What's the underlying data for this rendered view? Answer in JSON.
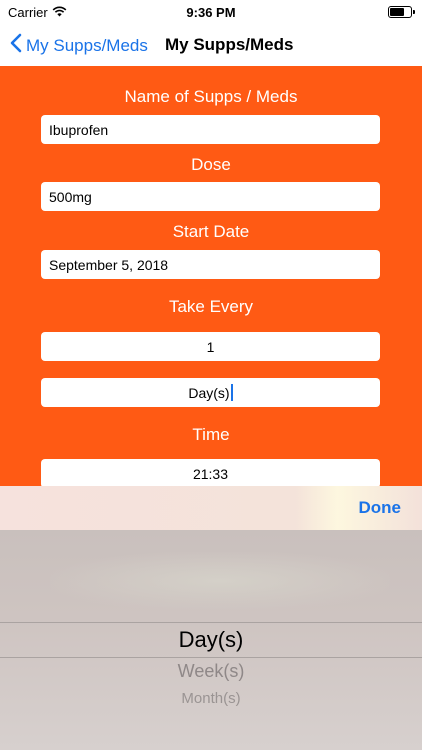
{
  "status": {
    "carrier": "Carrier",
    "time": "9:36 PM",
    "battery_level": 0.7
  },
  "nav": {
    "back_label": "My Supps/Meds",
    "title": "My Supps/Meds"
  },
  "form": {
    "name_label": "Name of Supps / Meds",
    "name_value": "Ibuprofen",
    "dose_label": "Dose",
    "dose_value": "500mg",
    "start_label": "Start Date",
    "start_value": "September 5, 2018",
    "take_label": "Take Every",
    "take_value": "1",
    "unit_value": "Day(s)",
    "time_label": "Time",
    "time_value": "21:33"
  },
  "toolbar": {
    "done_label": "Done"
  },
  "picker": {
    "selected": "Day(s)",
    "options": [
      "Day(s)",
      "Week(s)",
      "Month(s)"
    ]
  },
  "colors": {
    "accent": "#1a73e8",
    "form_bg": "#ff5a14"
  }
}
